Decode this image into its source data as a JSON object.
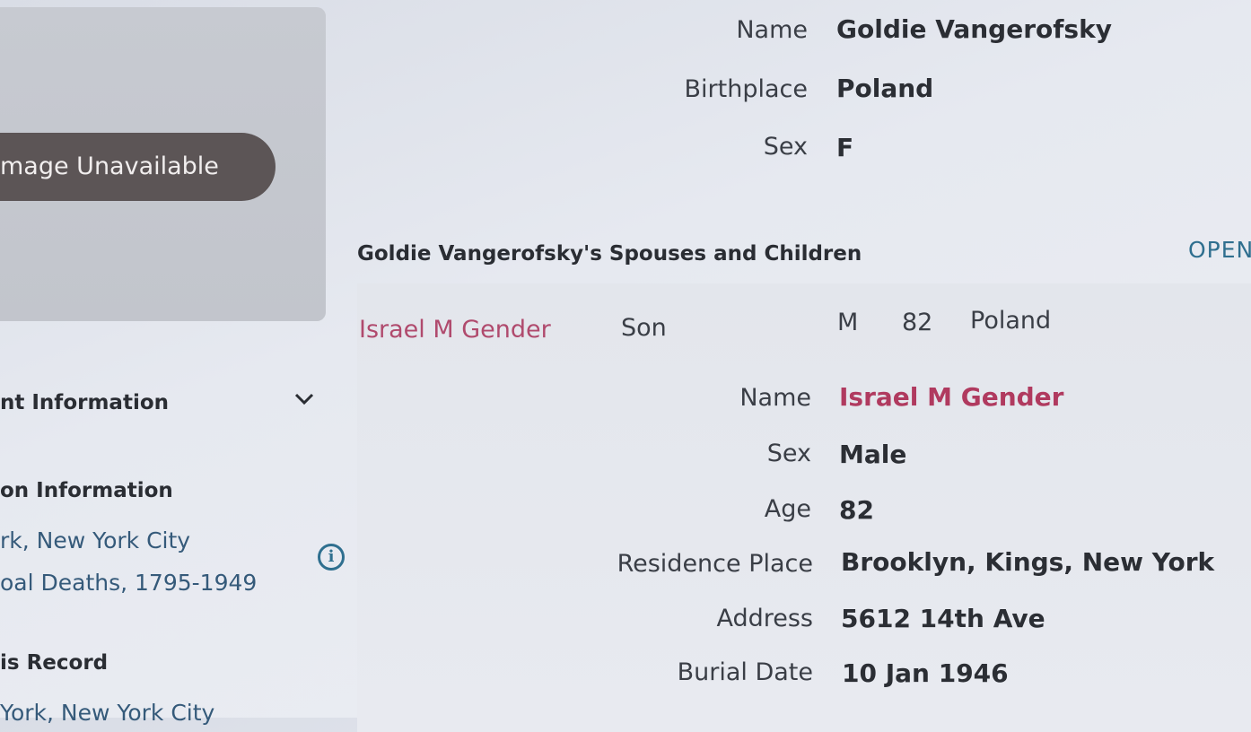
{
  "image_panel": {
    "label": "mage Unavailable"
  },
  "sidebar": {
    "section1_title": "nt Information",
    "section2_title": "on Information",
    "collection_line1": "rk, New York City",
    "collection_line2": "oal Deaths, 1795-1949",
    "section3_title": "is Record",
    "record_line1": "York, New York City"
  },
  "person": {
    "name_label": "Name",
    "name": "Goldie Vangerofsky",
    "birthplace_label": "Birthplace",
    "birthplace": "Poland",
    "sex_label": "Sex",
    "sex": "F"
  },
  "family": {
    "title": "Goldie Vangerofsky's Spouses and Children",
    "open_label": "OPEN",
    "rows": [
      {
        "name": "Israel M Gender",
        "relationship": "Son",
        "sex": "M",
        "age": "82",
        "birthplace": "Poland"
      }
    ]
  },
  "child_details": {
    "name_label": "Name",
    "name": "Israel M Gender",
    "sex_label": "Sex",
    "sex": "Male",
    "age_label": "Age",
    "age": "82",
    "residence_label": "Residence Place",
    "residence": "Brooklyn, Kings, New York",
    "address_label": "Address",
    "address": "5612 14th Ave",
    "burial_label": "Burial Date",
    "burial": "10 Jan 1946"
  }
}
